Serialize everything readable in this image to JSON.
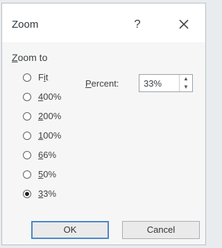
{
  "dialog": {
    "title": "Zoom",
    "help_glyph": "?",
    "close_icon": "close-icon"
  },
  "zoom_to": {
    "label_first": "Z",
    "label_rest": "oom to",
    "options": [
      {
        "prefix": "F",
        "underlined": "i",
        "suffix": "t",
        "selected": false
      },
      {
        "prefix": "",
        "underlined": "4",
        "suffix": "00%",
        "selected": false
      },
      {
        "prefix": "",
        "underlined": "2",
        "suffix": "00%",
        "selected": false
      },
      {
        "prefix": "",
        "underlined": "1",
        "suffix": "00%",
        "selected": false
      },
      {
        "prefix": "",
        "underlined": "6",
        "suffix": "6%",
        "selected": false
      },
      {
        "prefix": "",
        "underlined": "5",
        "suffix": "0%",
        "selected": false
      },
      {
        "prefix": "",
        "underlined": "3",
        "suffix": "3%",
        "selected": true
      }
    ]
  },
  "percent": {
    "label_underlined": "P",
    "label_rest": "ercent:",
    "value": "33%"
  },
  "buttons": {
    "ok_label": "OK",
    "cancel_label": "Cancel"
  }
}
